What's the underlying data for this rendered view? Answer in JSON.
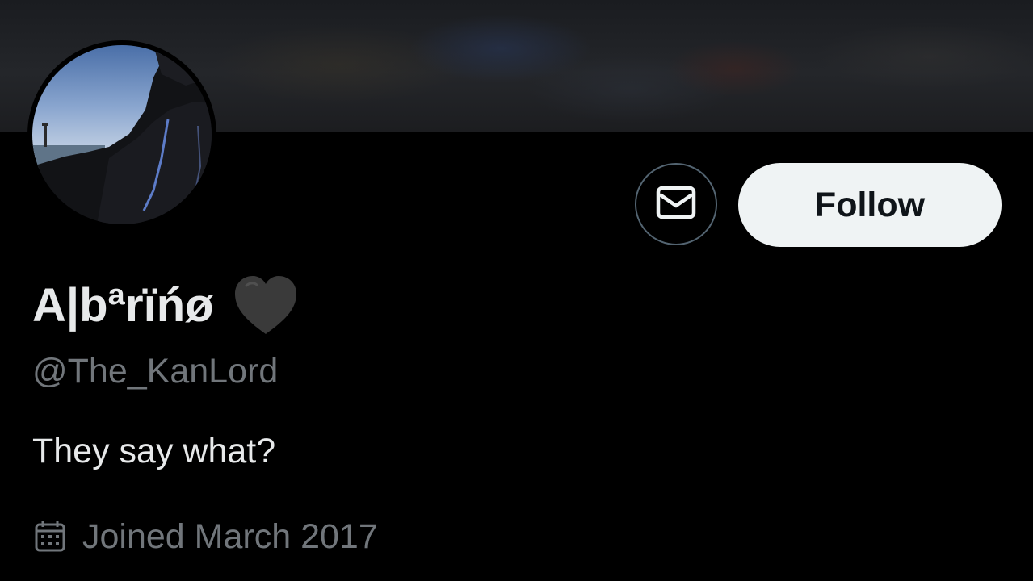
{
  "profile": {
    "display_name": "A|bªrïńø",
    "handle": "@The_KanLord",
    "bio": "They say what?",
    "joined": "Joined March 2017"
  },
  "actions": {
    "follow_label": "Follow"
  },
  "icons": {
    "message": "envelope-icon",
    "calendar": "calendar-icon",
    "emoji": "black-heart-icon"
  },
  "colors": {
    "background": "#000000",
    "primary_text": "#e7e9ea",
    "secondary_text": "#71767b",
    "follow_button_bg": "#eff3f4",
    "follow_button_text": "#0f1419",
    "outline_border": "#536471"
  }
}
